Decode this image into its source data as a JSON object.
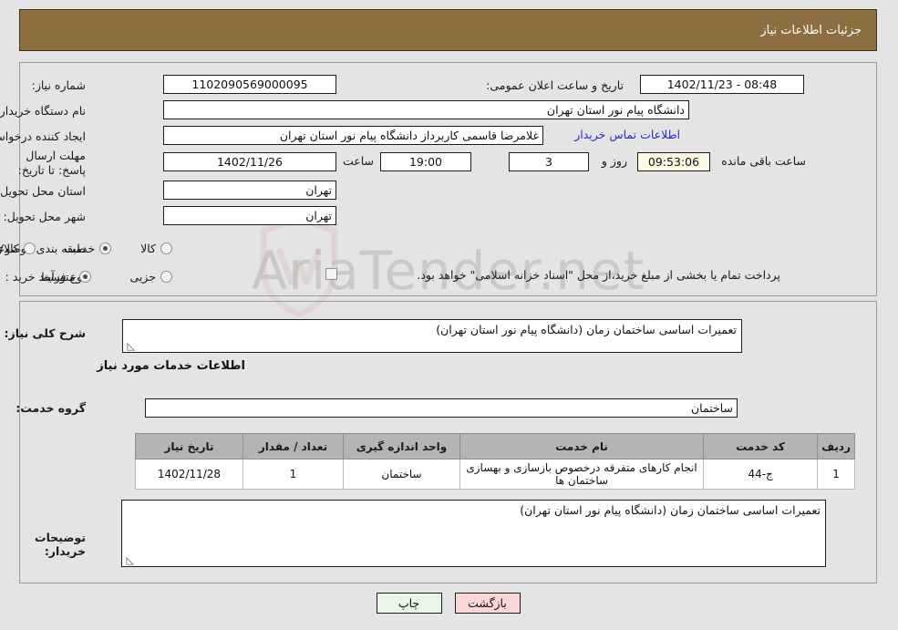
{
  "header": {
    "title": "جزئیات اطلاعات نیاز"
  },
  "watermark": {
    "text": "AriaTender.net"
  },
  "summary": {
    "need_number": {
      "label": "شماره نیاز:",
      "value": "1102090569000095"
    },
    "public_announce": {
      "label": "تاریخ و ساعت اعلان عمومی:",
      "value": "08:48 - 1402/11/23"
    },
    "buyer_org": {
      "label": "نام دستگاه خریدار:",
      "value": "دانشگاه پیام نور استان تهران"
    },
    "requester": {
      "label": "ایجاد کننده درخواست:",
      "value": "غلامرضا قاسمی کاربرداز دانشگاه پیام نور استان تهران"
    },
    "contact_link": "اطلاعات تماس خریدار",
    "deadline": {
      "label": "مهلت ارسال پاسخ: تا تاریخ:",
      "date": "1402/11/26",
      "time_label": "ساعت",
      "time": "19:00",
      "days": "3",
      "days_label": "روز و",
      "countdown": "09:53:06",
      "countdown_label": "ساعت باقی مانده",
      "extra_value": ""
    },
    "delivery_province": {
      "label": "استان محل تحویل:",
      "value": "تهران"
    },
    "delivery_city": {
      "label": "شهر محل تحویل:",
      "value": "تهران"
    },
    "category": {
      "label": "طبقه بندی موضوعی:",
      "options": [
        "کالا",
        "خدمت",
        "کالا/خدمت"
      ],
      "selected": "خدمت"
    },
    "purchase_type": {
      "label": "نوع فرآیند خرید :",
      "options": [
        "جزیی",
        "متوسط"
      ],
      "selected": "متوسط",
      "treasury_checkbox_checked": false,
      "treasury_note": "پرداخت تمام یا بخشی از مبلغ خرید،از محل \"اسناد خزانه اسلامی\" خواهد بود."
    }
  },
  "details": {
    "general_desc": {
      "label": "شرح کلی نیاز:",
      "value": "تعمیرات اساسی ساختمان زمان (دانشگاه پیام نور استان تهران)"
    },
    "services_heading": "اطلاعات خدمات مورد نیاز",
    "service_group": {
      "label": "گروه خدمت:",
      "value": "ساختمان"
    },
    "table": {
      "columns": [
        "ردیف",
        "کد خدمت",
        "نام خدمت",
        "واحد اندازه گیری",
        "تعداد / مقدار",
        "تاریخ نیاز"
      ],
      "rows": [
        {
          "row": "1",
          "code": "ج-44",
          "name": "انجام کارهای متفرقه درخصوص بازسازی و بهسازی ساختمان ها",
          "unit": "ساختمان",
          "qty": "1",
          "need_date": "1402/11/28"
        }
      ]
    },
    "buyer_notes": {
      "label": "توضیحات خریدار:",
      "value": "تعمیرات اساسی ساختمان زمان (دانشگاه پیام نور استان تهران)"
    }
  },
  "actions": {
    "print": "چاپ",
    "back": "بازگشت"
  },
  "colors": {
    "header_bar": "#8d6e41",
    "page_bg": "#e4e4e4",
    "table_header": "#b4b4b4",
    "link": "#2727d6",
    "btn_print_bg": "#e9f7e9",
    "btn_back_bg": "#fbd6d6",
    "countdown_bg": "#fbf8e3"
  }
}
